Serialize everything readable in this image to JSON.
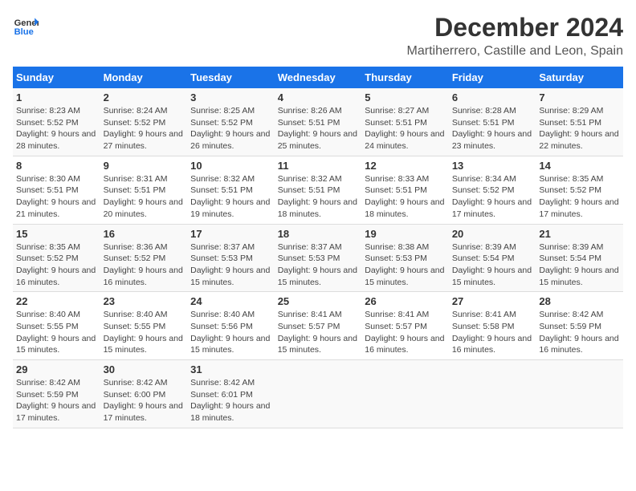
{
  "logo": {
    "text_general": "General",
    "text_blue": "Blue"
  },
  "title": "December 2024",
  "subtitle": "Martiherrero, Castille and Leon, Spain",
  "weekdays": [
    "Sunday",
    "Monday",
    "Tuesday",
    "Wednesday",
    "Thursday",
    "Friday",
    "Saturday"
  ],
  "weeks": [
    [
      {
        "day": "1",
        "sunrise": "8:23 AM",
        "sunset": "5:52 PM",
        "daylight": "9 hours and 28 minutes."
      },
      {
        "day": "2",
        "sunrise": "8:24 AM",
        "sunset": "5:52 PM",
        "daylight": "9 hours and 27 minutes."
      },
      {
        "day": "3",
        "sunrise": "8:25 AM",
        "sunset": "5:52 PM",
        "daylight": "9 hours and 26 minutes."
      },
      {
        "day": "4",
        "sunrise": "8:26 AM",
        "sunset": "5:51 PM",
        "daylight": "9 hours and 25 minutes."
      },
      {
        "day": "5",
        "sunrise": "8:27 AM",
        "sunset": "5:51 PM",
        "daylight": "9 hours and 24 minutes."
      },
      {
        "day": "6",
        "sunrise": "8:28 AM",
        "sunset": "5:51 PM",
        "daylight": "9 hours and 23 minutes."
      },
      {
        "day": "7",
        "sunrise": "8:29 AM",
        "sunset": "5:51 PM",
        "daylight": "9 hours and 22 minutes."
      }
    ],
    [
      {
        "day": "8",
        "sunrise": "8:30 AM",
        "sunset": "5:51 PM",
        "daylight": "9 hours and 21 minutes."
      },
      {
        "day": "9",
        "sunrise": "8:31 AM",
        "sunset": "5:51 PM",
        "daylight": "9 hours and 20 minutes."
      },
      {
        "day": "10",
        "sunrise": "8:32 AM",
        "sunset": "5:51 PM",
        "daylight": "9 hours and 19 minutes."
      },
      {
        "day": "11",
        "sunrise": "8:32 AM",
        "sunset": "5:51 PM",
        "daylight": "9 hours and 18 minutes."
      },
      {
        "day": "12",
        "sunrise": "8:33 AM",
        "sunset": "5:51 PM",
        "daylight": "9 hours and 18 minutes."
      },
      {
        "day": "13",
        "sunrise": "8:34 AM",
        "sunset": "5:52 PM",
        "daylight": "9 hours and 17 minutes."
      },
      {
        "day": "14",
        "sunrise": "8:35 AM",
        "sunset": "5:52 PM",
        "daylight": "9 hours and 17 minutes."
      }
    ],
    [
      {
        "day": "15",
        "sunrise": "8:35 AM",
        "sunset": "5:52 PM",
        "daylight": "9 hours and 16 minutes."
      },
      {
        "day": "16",
        "sunrise": "8:36 AM",
        "sunset": "5:52 PM",
        "daylight": "9 hours and 16 minutes."
      },
      {
        "day": "17",
        "sunrise": "8:37 AM",
        "sunset": "5:53 PM",
        "daylight": "9 hours and 15 minutes."
      },
      {
        "day": "18",
        "sunrise": "8:37 AM",
        "sunset": "5:53 PM",
        "daylight": "9 hours and 15 minutes."
      },
      {
        "day": "19",
        "sunrise": "8:38 AM",
        "sunset": "5:53 PM",
        "daylight": "9 hours and 15 minutes."
      },
      {
        "day": "20",
        "sunrise": "8:39 AM",
        "sunset": "5:54 PM",
        "daylight": "9 hours and 15 minutes."
      },
      {
        "day": "21",
        "sunrise": "8:39 AM",
        "sunset": "5:54 PM",
        "daylight": "9 hours and 15 minutes."
      }
    ],
    [
      {
        "day": "22",
        "sunrise": "8:40 AM",
        "sunset": "5:55 PM",
        "daylight": "9 hours and 15 minutes."
      },
      {
        "day": "23",
        "sunrise": "8:40 AM",
        "sunset": "5:55 PM",
        "daylight": "9 hours and 15 minutes."
      },
      {
        "day": "24",
        "sunrise": "8:40 AM",
        "sunset": "5:56 PM",
        "daylight": "9 hours and 15 minutes."
      },
      {
        "day": "25",
        "sunrise": "8:41 AM",
        "sunset": "5:57 PM",
        "daylight": "9 hours and 15 minutes."
      },
      {
        "day": "26",
        "sunrise": "8:41 AM",
        "sunset": "5:57 PM",
        "daylight": "9 hours and 16 minutes."
      },
      {
        "day": "27",
        "sunrise": "8:41 AM",
        "sunset": "5:58 PM",
        "daylight": "9 hours and 16 minutes."
      },
      {
        "day": "28",
        "sunrise": "8:42 AM",
        "sunset": "5:59 PM",
        "daylight": "9 hours and 16 minutes."
      }
    ],
    [
      {
        "day": "29",
        "sunrise": "8:42 AM",
        "sunset": "5:59 PM",
        "daylight": "9 hours and 17 minutes."
      },
      {
        "day": "30",
        "sunrise": "8:42 AM",
        "sunset": "6:00 PM",
        "daylight": "9 hours and 17 minutes."
      },
      {
        "day": "31",
        "sunrise": "8:42 AM",
        "sunset": "6:01 PM",
        "daylight": "9 hours and 18 minutes."
      },
      null,
      null,
      null,
      null
    ]
  ],
  "labels": {
    "sunrise": "Sunrise:",
    "sunset": "Sunset:",
    "daylight": "Daylight hours"
  }
}
